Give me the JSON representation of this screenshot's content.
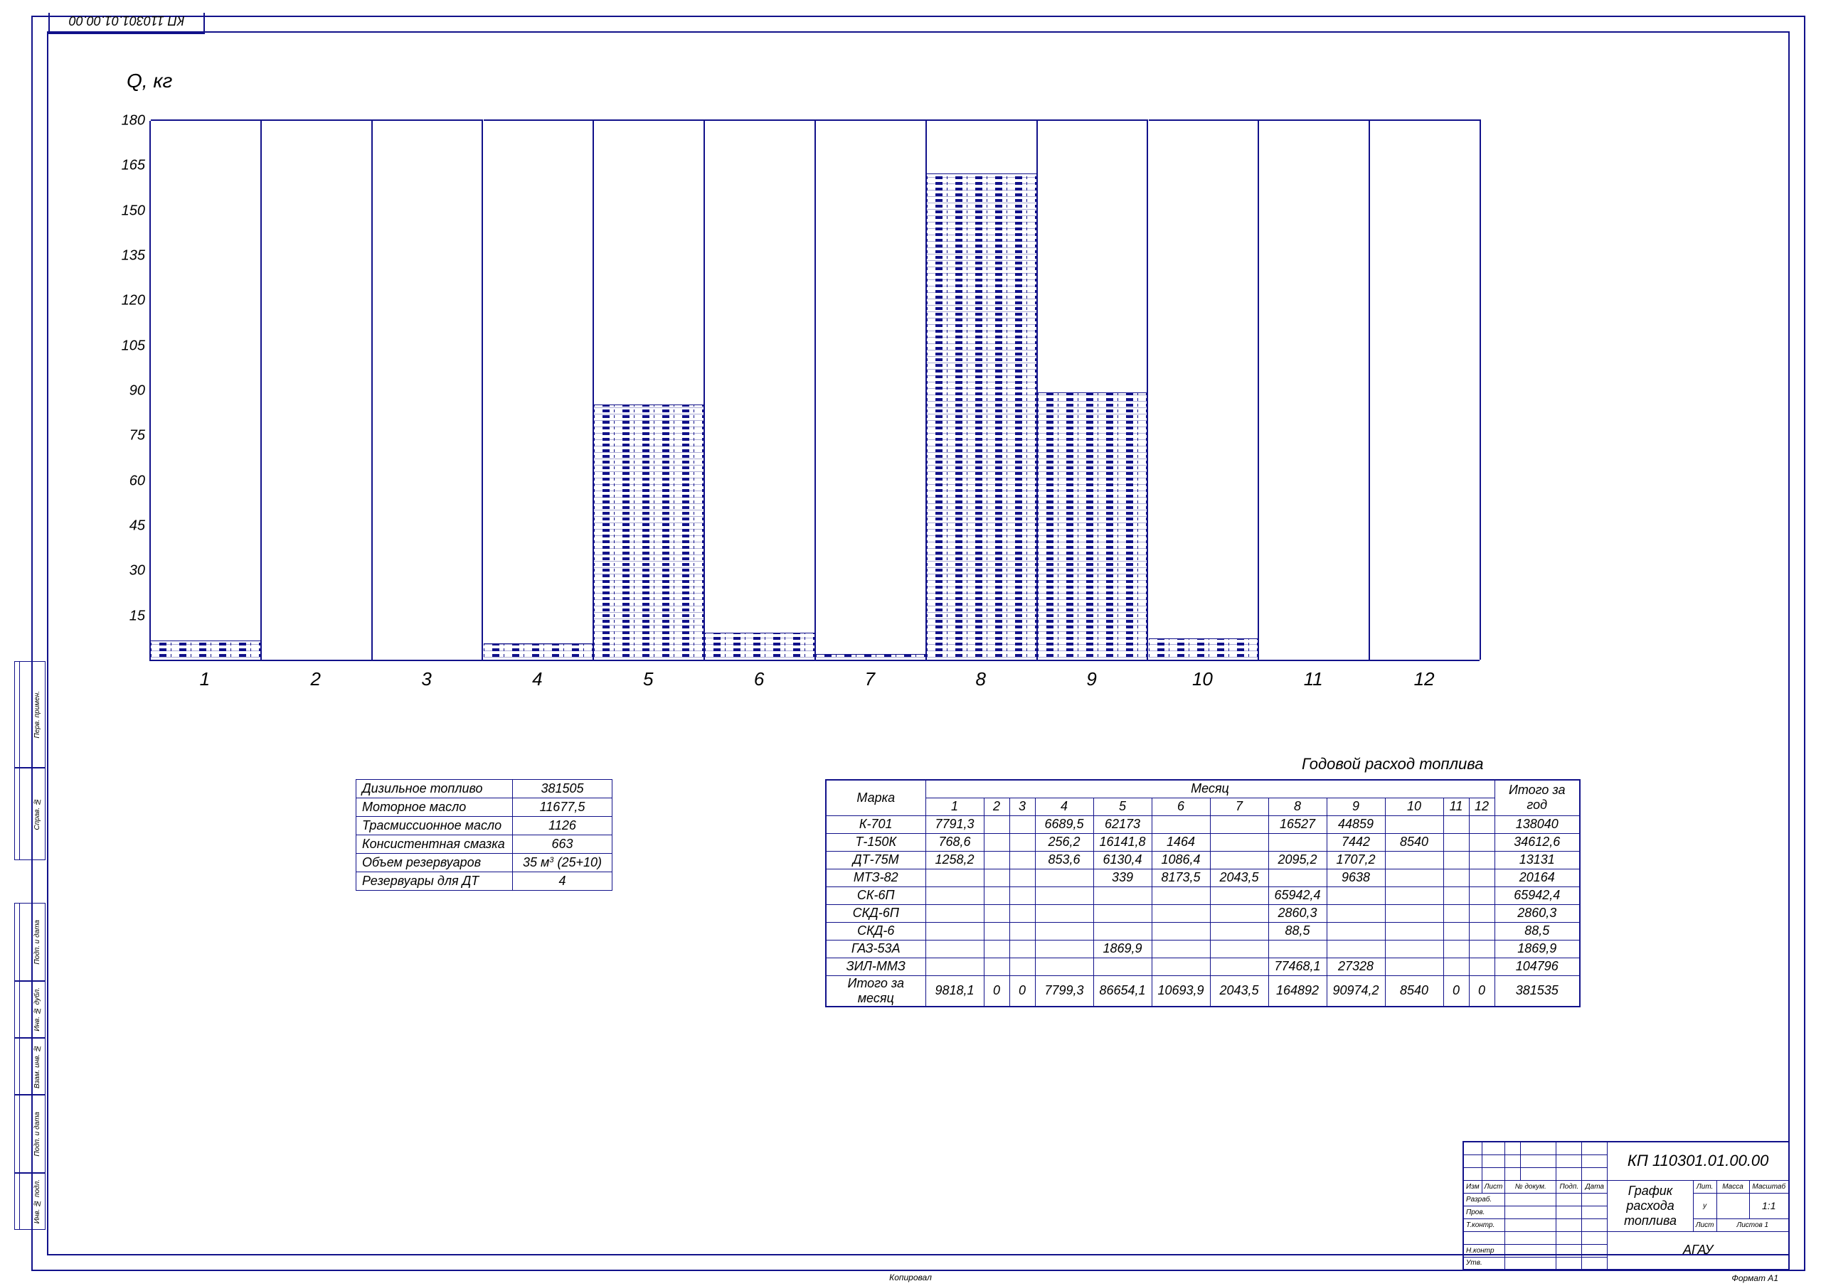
{
  "doc_code_top": "КП 110301.01.00.00",
  "y_axis_label": "Q, кг",
  "chart_data": {
    "type": "bar",
    "categories": [
      "1",
      "2",
      "3",
      "4",
      "5",
      "6",
      "7",
      "8",
      "9",
      "10",
      "11",
      "12"
    ],
    "values": [
      6.5,
      0,
      0,
      5.5,
      85,
      9,
      2,
      162,
      89,
      7,
      0,
      0
    ],
    "ylabel": "Q, кг",
    "ylim": [
      0,
      180
    ],
    "y_ticks": [
      15,
      30,
      45,
      60,
      75,
      90,
      105,
      120,
      135,
      150,
      165,
      180
    ]
  },
  "summary": {
    "rows": [
      [
        "Дизильное топливо",
        "381505"
      ],
      [
        "Моторное масло",
        "11677,5"
      ],
      [
        "Трасмиссионное масло",
        "1126"
      ],
      [
        "Консистентная смазка",
        "663"
      ],
      [
        "Объем резервуаров",
        "35 м³ (25+10)"
      ],
      [
        "Резервуары для ДТ",
        "4"
      ]
    ]
  },
  "main_table_title": "Годовой расход топлива",
  "main_table": {
    "head_model": "Марка",
    "head_month": "Месяц",
    "head_total": "Итого за год",
    "months": [
      "1",
      "2",
      "3",
      "4",
      "5",
      "6",
      "7",
      "8",
      "9",
      "10",
      "11",
      "12"
    ],
    "narrow_months": [
      2,
      3,
      11,
      12
    ],
    "rows": [
      {
        "model": "К-701",
        "cells": [
          "7791,3",
          "",
          "",
          "6689,5",
          "62173",
          "",
          "",
          "16527",
          "44859",
          "",
          "",
          ""
        ],
        "total": "138040"
      },
      {
        "model": "Т-150К",
        "cells": [
          "768,6",
          "",
          "",
          "256,2",
          "16141,8",
          "1464",
          "",
          "",
          "7442",
          "8540",
          "",
          ""
        ],
        "total": "34612,6"
      },
      {
        "model": "ДТ-75М",
        "cells": [
          "1258,2",
          "",
          "",
          "853,6",
          "6130,4",
          "1086,4",
          "",
          "2095,2",
          "1707,2",
          "",
          "",
          ""
        ],
        "total": "13131"
      },
      {
        "model": "МТЗ-82",
        "cells": [
          "",
          "",
          "",
          "",
          "339",
          "8173,5",
          "2043,5",
          "",
          "9638",
          "",
          "",
          ""
        ],
        "total": "20164"
      },
      {
        "model": "СК-6П",
        "cells": [
          "",
          "",
          "",
          "",
          "",
          "",
          "",
          "65942,4",
          "",
          "",
          "",
          ""
        ],
        "total": "65942,4"
      },
      {
        "model": "СКД-6П",
        "cells": [
          "",
          "",
          "",
          "",
          "",
          "",
          "",
          "2860,3",
          "",
          "",
          "",
          ""
        ],
        "total": "2860,3"
      },
      {
        "model": "СКД-6",
        "cells": [
          "",
          "",
          "",
          "",
          "",
          "",
          "",
          "88,5",
          "",
          "",
          "",
          ""
        ],
        "total": "88,5"
      },
      {
        "model": "ГАЗ-53А",
        "cells": [
          "",
          "",
          "",
          "",
          "1869,9",
          "",
          "",
          "",
          "",
          "",
          "",
          ""
        ],
        "total": "1869,9"
      },
      {
        "model": "ЗИЛ-ММЗ",
        "cells": [
          "",
          "",
          "",
          "",
          "",
          "",
          "",
          "77468,1",
          "27328",
          "",
          "",
          ""
        ],
        "total": "104796"
      }
    ],
    "total_row": {
      "label": "Итого за месяц",
      "cells": [
        "9818,1",
        "0",
        "0",
        "7799,3",
        "86654,1",
        "10693,9",
        "2043,5",
        "164892",
        "90974,2",
        "8540",
        "0",
        "0"
      ],
      "total": "381535"
    }
  },
  "title_block": {
    "doc_code": "КП 110301.01.00.00",
    "name_line1": "График расхода",
    "name_line2": "топлива",
    "scale": "1:1",
    "org": "АГАУ",
    "format": "Формат   А1",
    "cols": {
      "izm": "Изм",
      "list": "Лист",
      "ndokum": "№ докум.",
      "podp": "Подп.",
      "data": "Дата",
      "razrab": "Разраб.",
      "prov": "Пров.",
      "tkontr": "Т.контр.",
      "nkontr": "Н.контр",
      "utv": "Утв.",
      "lit": "Лит.",
      "massa": "Масса",
      "masht": "Масштаб",
      "list2": "Лист",
      "listov": "Листов   1"
    }
  },
  "left_labels": [
    "Перв. примен.",
    "Справ. №",
    "Подп. и дата",
    "Инв. № дубл.",
    "Взам. инв. №",
    "Подп. и дата",
    "Инв. № подл."
  ],
  "bottom_center": "Копировал",
  "bottom_right": "Формат   А1"
}
